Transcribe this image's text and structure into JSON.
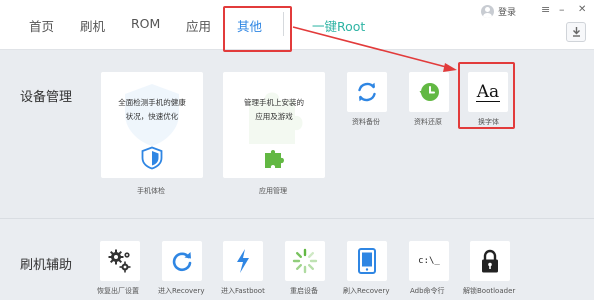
{
  "nav": {
    "items": [
      "首页",
      "刷机",
      "ROM",
      "应用",
      "其他",
      "一键Root"
    ],
    "active_index": 4,
    "login": "登录",
    "win_controls": [
      "≡",
      "–",
      "✕"
    ]
  },
  "device_mgmt": {
    "title": "设备管理",
    "cards": [
      {
        "desc_line1": "全面检测手机的健康",
        "desc_line2": "状况，快速优化",
        "label": "手机体检",
        "icon": "shield-icon"
      },
      {
        "desc_line1": "管理手机上安装的",
        "desc_line2": "应用及游戏",
        "label": "应用管理",
        "icon": "puzzle-icon"
      }
    ],
    "tools": [
      {
        "label": "资料备份",
        "icon": "sync-icon"
      },
      {
        "label": "资料还原",
        "icon": "restore-icon"
      },
      {
        "label": "换字体",
        "icon": "font-icon",
        "glyph": "Aa"
      }
    ]
  },
  "flash_assist": {
    "title": "刷机辅助",
    "tools": [
      {
        "label": "恢复出厂设置",
        "icon": "gears-icon"
      },
      {
        "label": "进入Recovery",
        "icon": "refresh-icon"
      },
      {
        "label": "进入Fastboot",
        "icon": "lightning-icon"
      },
      {
        "label": "重启设备",
        "icon": "spinner-icon"
      },
      {
        "label": "刷入Recovery",
        "icon": "phone-icon"
      },
      {
        "label": "Adb命令行",
        "icon": "terminal-icon",
        "glyph": "c:\\_"
      },
      {
        "label": "解锁Bootloader",
        "icon": "lock-icon"
      }
    ]
  },
  "colors": {
    "accent": "#2f86e3",
    "teal": "#2fb4a4",
    "green": "#62b843",
    "annotation": "#e23b3b"
  }
}
